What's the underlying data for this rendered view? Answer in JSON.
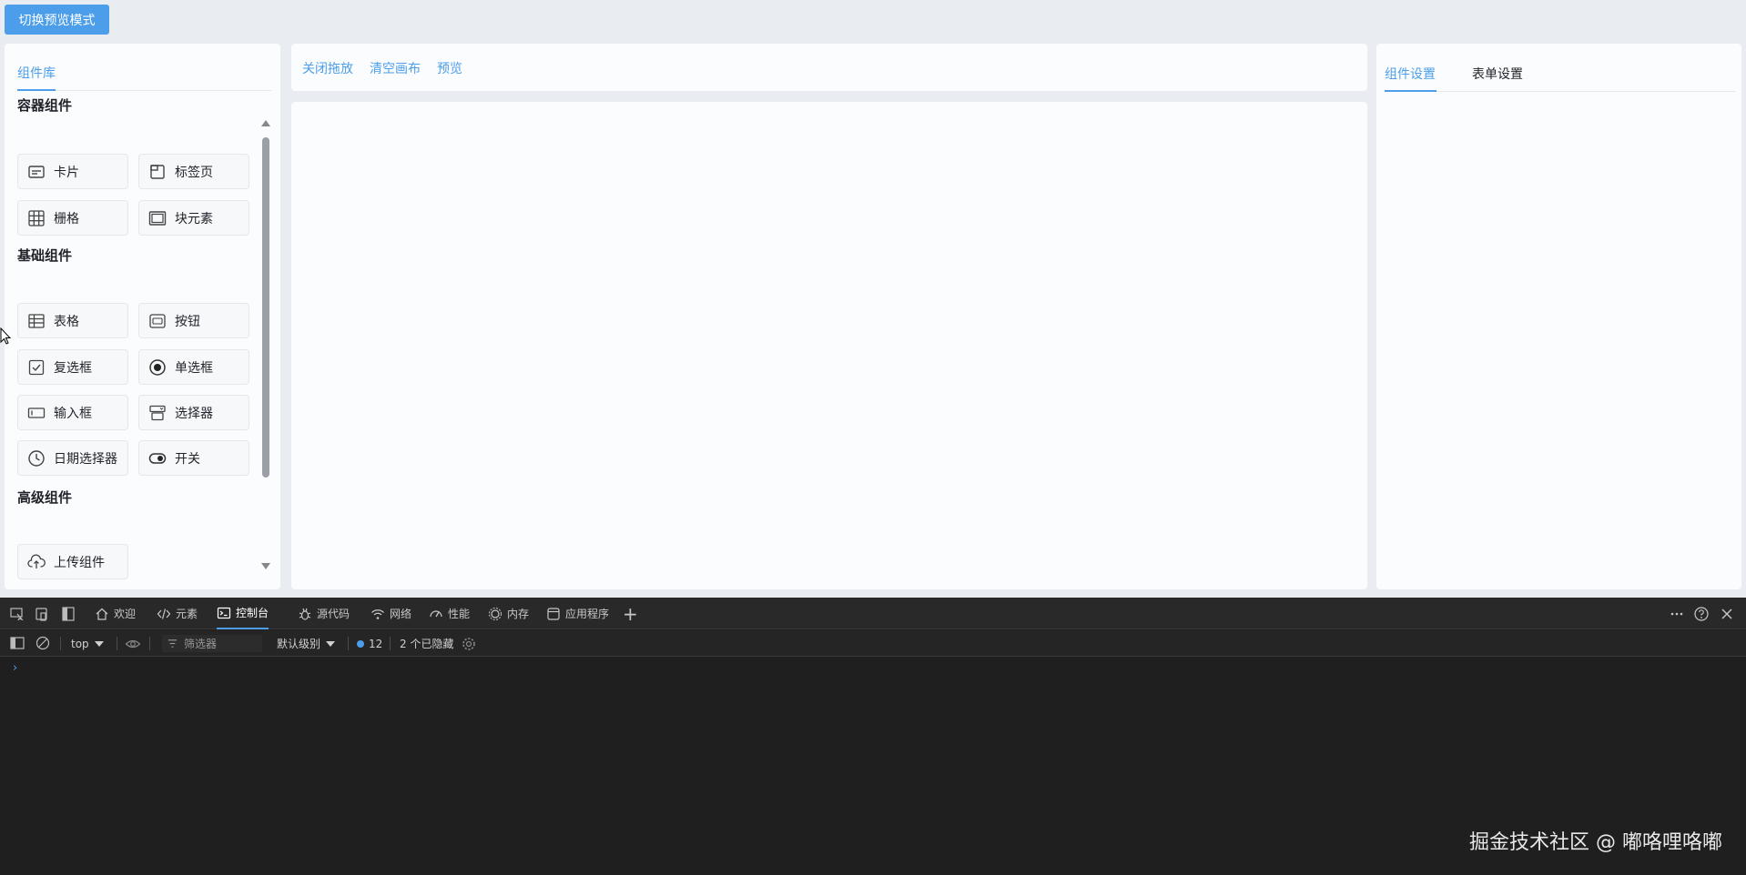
{
  "header": {
    "mode_button_label": "切换预览模式"
  },
  "left_panel": {
    "tab_label": "组件库",
    "sections": [
      {
        "title": "容器组件",
        "items": [
          {
            "label": "卡片",
            "icon": "card-icon"
          },
          {
            "label": "标签页",
            "icon": "tabs-icon"
          },
          {
            "label": "栅格",
            "icon": "grid-icon"
          },
          {
            "label": "块元素",
            "icon": "block-icon"
          }
        ]
      },
      {
        "title": "基础组件",
        "items": [
          {
            "label": "表格",
            "icon": "table-icon"
          },
          {
            "label": "按钮",
            "icon": "button-icon"
          },
          {
            "label": "复选框",
            "icon": "checkbox-icon"
          },
          {
            "label": "单选框",
            "icon": "radio-icon"
          },
          {
            "label": "输入框",
            "icon": "input-icon"
          },
          {
            "label": "选择器",
            "icon": "select-icon"
          },
          {
            "label": "日期选择器",
            "icon": "clock-icon"
          },
          {
            "label": "开关",
            "icon": "switch-icon"
          }
        ]
      },
      {
        "title": "高级组件",
        "items": [
          {
            "label": "上传组件",
            "icon": "upload-icon"
          }
        ]
      }
    ]
  },
  "toolbar": {
    "close_drag": "关闭拖放",
    "clear_canvas": "清空画布",
    "preview": "预览"
  },
  "right_panel": {
    "tabs": [
      {
        "label": "组件设置",
        "active": true
      },
      {
        "label": "表单设置",
        "active": false
      }
    ]
  },
  "devtools": {
    "tabs": [
      {
        "label": "欢迎",
        "icon": "home-icon"
      },
      {
        "label": "元素",
        "icon": "code-icon"
      },
      {
        "label": "控制台",
        "icon": "console-icon",
        "active": true
      },
      {
        "label": "源代码",
        "icon": "bug-icon"
      },
      {
        "label": "网络",
        "icon": "wifi-icon"
      },
      {
        "label": "性能",
        "icon": "gauge-icon"
      },
      {
        "label": "内存",
        "icon": "memory-icon"
      },
      {
        "label": "应用程序",
        "icon": "app-icon"
      }
    ],
    "context": "top",
    "filter_placeholder": "筛选器",
    "level": "默认级别",
    "message_count": "12",
    "hidden_count": "2 个已隐藏",
    "prompt": "›"
  },
  "watermark": "掘金技术社区 @ 嘟咯哩咯嘟",
  "colors": {
    "accent": "#4c9eea",
    "devtools_bg": "#1f1f1f"
  }
}
